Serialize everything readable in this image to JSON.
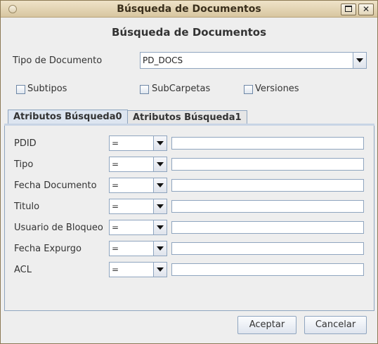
{
  "window": {
    "title": "Búsqueda de Documentos"
  },
  "heading": "Búsqueda de Documentos",
  "doc_type": {
    "label": "Tipo de Documento",
    "selected": "PD_DOCS"
  },
  "options": {
    "subtipos": "Subtipos",
    "subcarpetas": "SubCarpetas",
    "versiones": "Versiones"
  },
  "tabs": [
    {
      "label": "Atributos Búsqueda0",
      "active": true
    },
    {
      "label": "Atributos Búsqueda1",
      "active": false
    }
  ],
  "rows": [
    {
      "label": "PDID",
      "operator": "="
    },
    {
      "label": "Tipo",
      "operator": "="
    },
    {
      "label": "Fecha Documento",
      "operator": "="
    },
    {
      "label": "Titulo",
      "operator": "="
    },
    {
      "label": "Usuario de Bloqueo",
      "operator": "="
    },
    {
      "label": "Fecha Expurgo",
      "operator": "="
    },
    {
      "label": "ACL",
      "operator": "="
    }
  ],
  "buttons": {
    "accept": "Aceptar",
    "cancel": "Cancelar"
  }
}
